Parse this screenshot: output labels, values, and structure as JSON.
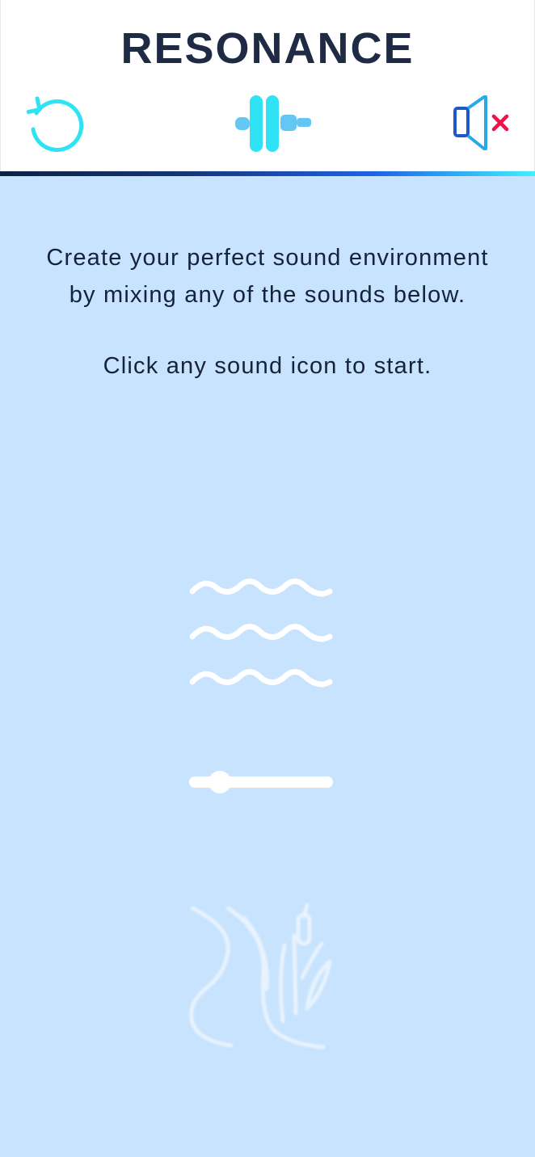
{
  "app": {
    "title": "RESONANCE"
  },
  "toolbar": {
    "reset_icon": "reset-icon",
    "mixer_icon": "mixer-icon",
    "mute_icon": "speaker-muted-icon"
  },
  "main": {
    "intro_line1": "Create your perfect sound environment",
    "intro_line2": "by mixing any of the sounds below.",
    "start_hint": "Click any sound icon to start."
  },
  "sounds": [
    {
      "icon": "water-waves-icon",
      "volume": 0.2,
      "active": true
    },
    {
      "icon": "marsh-reeds-icon",
      "active": false
    }
  ],
  "colors": {
    "title": "#1f2a44",
    "accent_cyan": "#2fe3f4",
    "accent_blue": "#1e63e6",
    "muted_x": "#f0134a",
    "background": "#c7e3fd"
  }
}
